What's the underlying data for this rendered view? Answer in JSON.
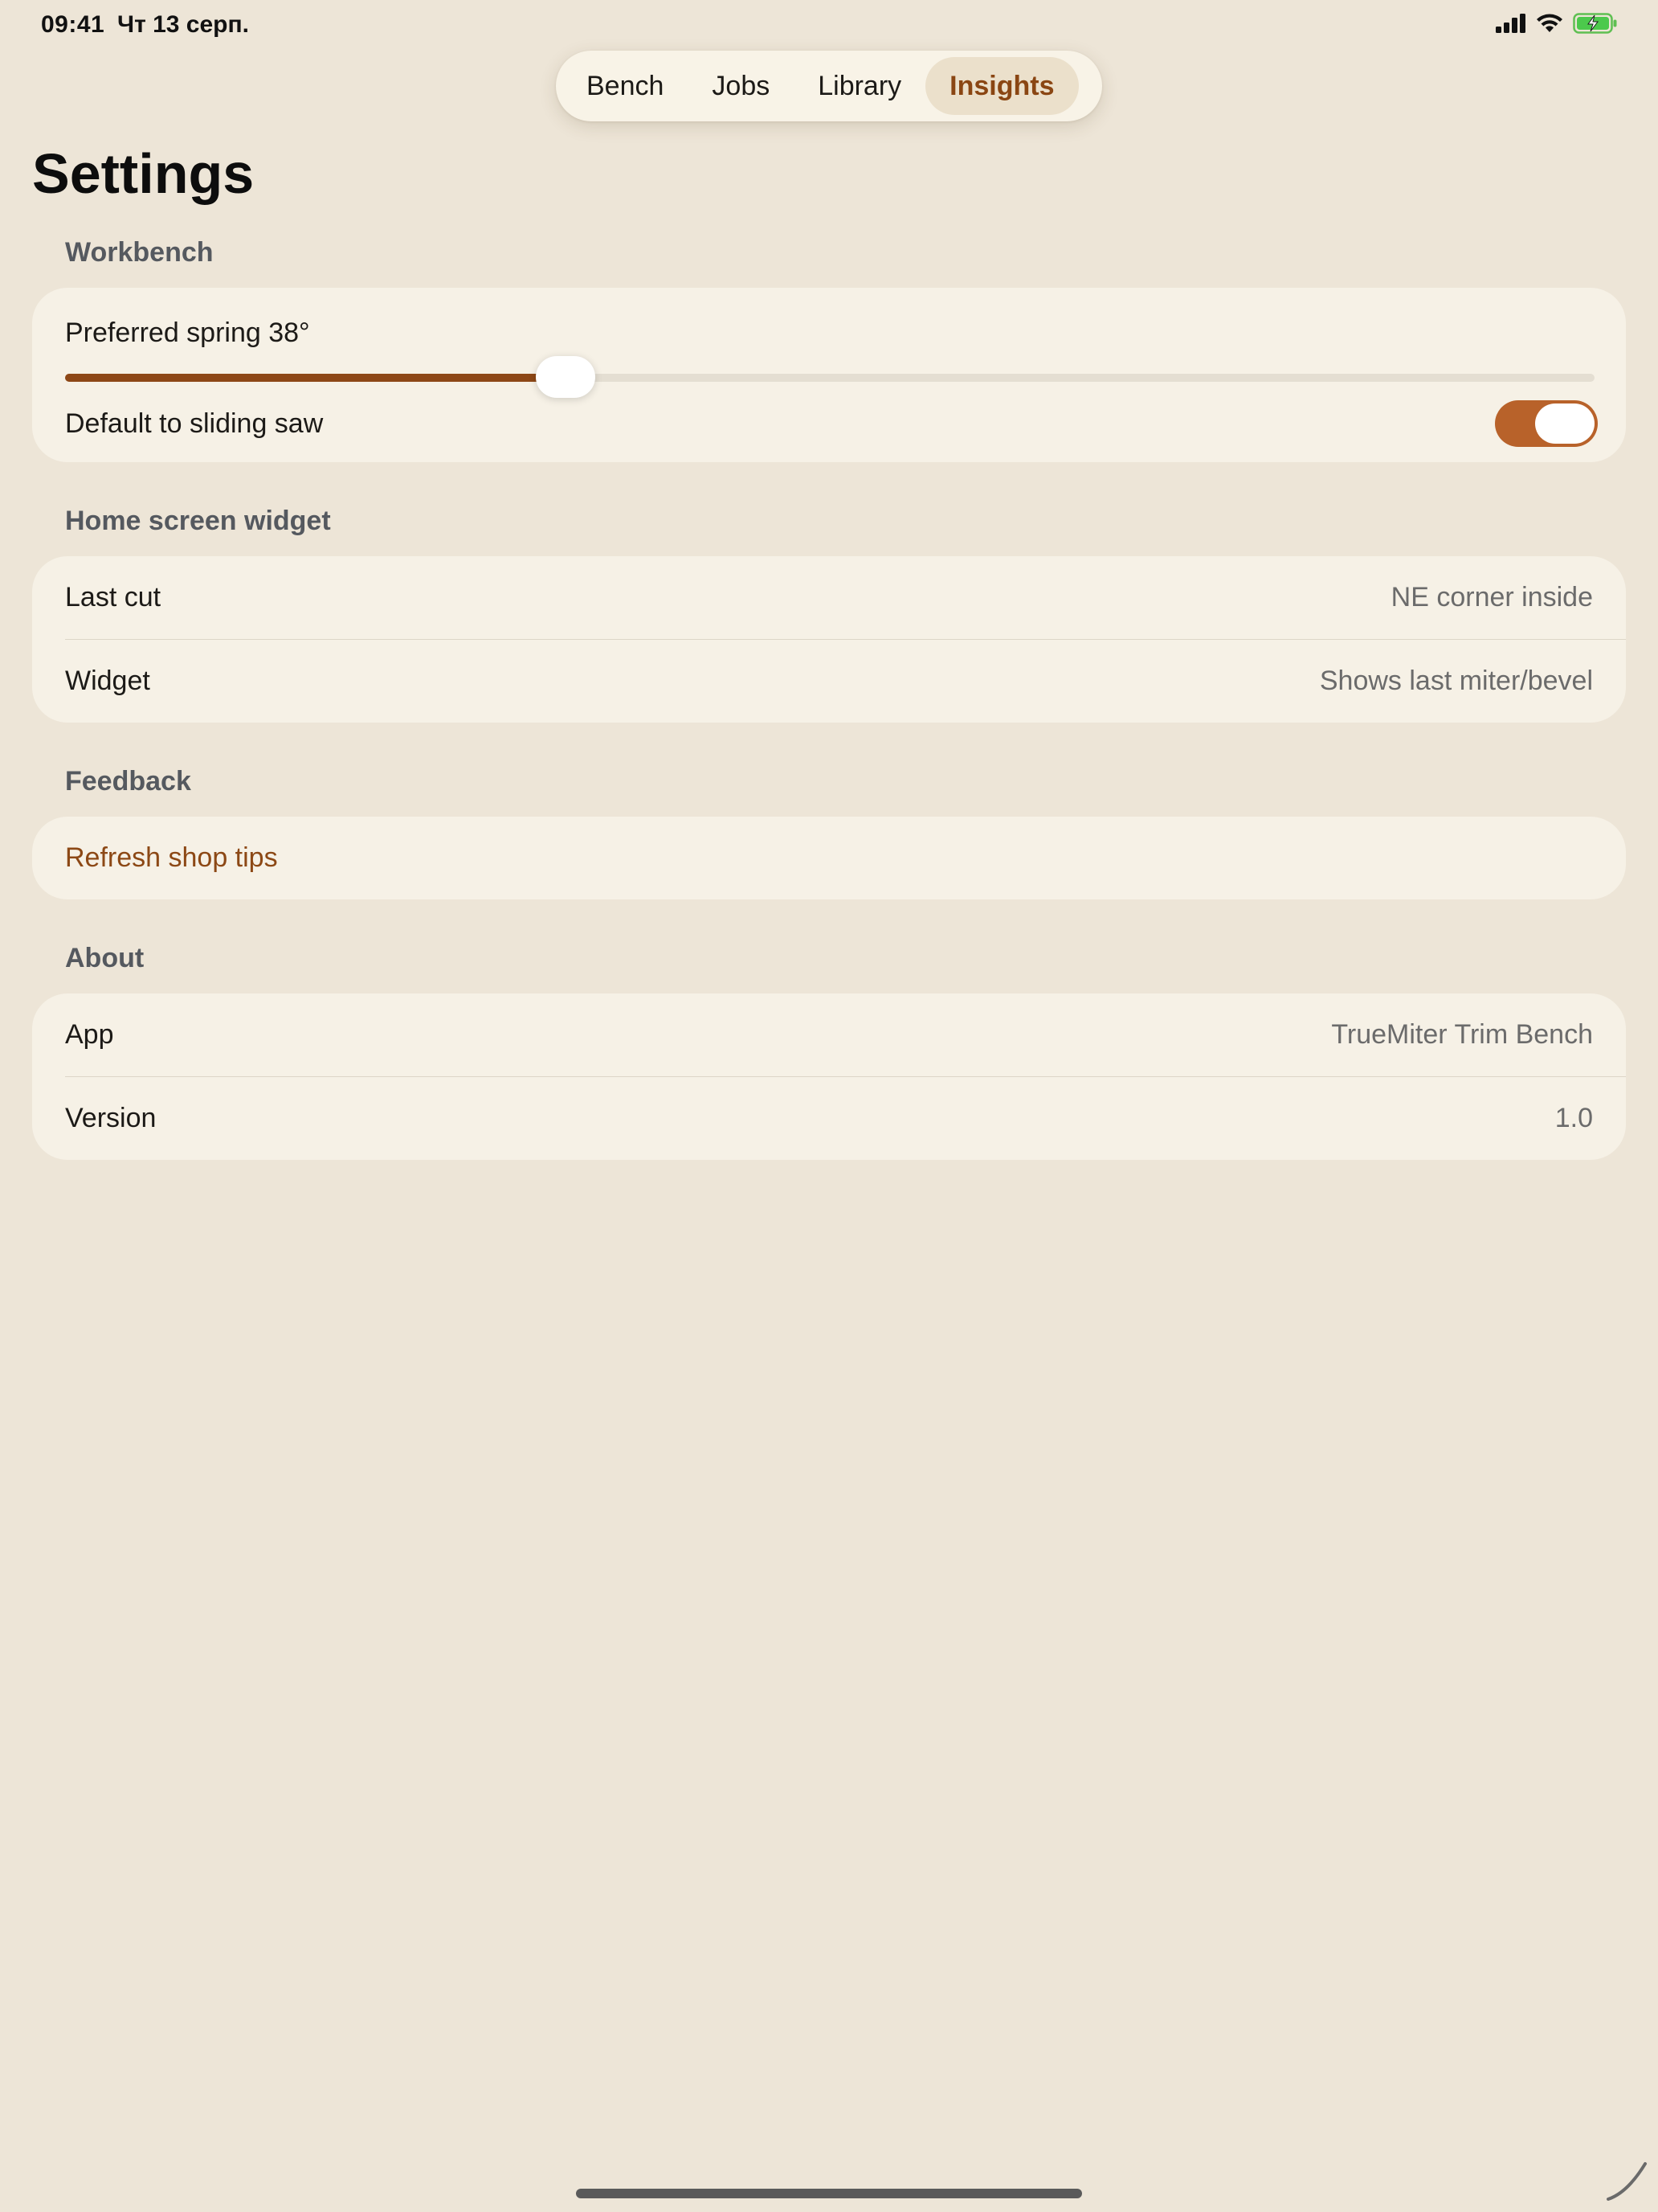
{
  "status_bar": {
    "time": "09:41",
    "date": "Чт 13 серп.",
    "icons": [
      "cellular-signal-icon",
      "wifi-icon",
      "battery-charging-icon"
    ]
  },
  "tabs": [
    {
      "label": "Bench",
      "active": false
    },
    {
      "label": "Jobs",
      "active": false
    },
    {
      "label": "Library",
      "active": false
    },
    {
      "label": "Insights",
      "active": true
    }
  ],
  "page_title": "Settings",
  "sections": {
    "workbench": {
      "header": "Workbench",
      "spring_label": "Preferred spring 38°",
      "spring_slider_fraction": 0.327,
      "sliding_saw_label": "Default to sliding saw",
      "sliding_saw_on": true
    },
    "widget": {
      "header": "Home screen widget",
      "rows": [
        {
          "label": "Last cut",
          "value": "NE corner inside"
        },
        {
          "label": "Widget",
          "value": "Shows last miter/bevel"
        }
      ]
    },
    "feedback": {
      "header": "Feedback",
      "refresh_label": "Refresh shop tips"
    },
    "about": {
      "header": "About",
      "rows": [
        {
          "label": "App",
          "value": "TrueMiter Trim Bench"
        },
        {
          "label": "Version",
          "value": "1.0"
        }
      ]
    }
  },
  "colors": {
    "background": "#ede5d7",
    "card": "#f6f1e6",
    "accent": "#8c4815",
    "toggle_on": "#b8622a"
  }
}
